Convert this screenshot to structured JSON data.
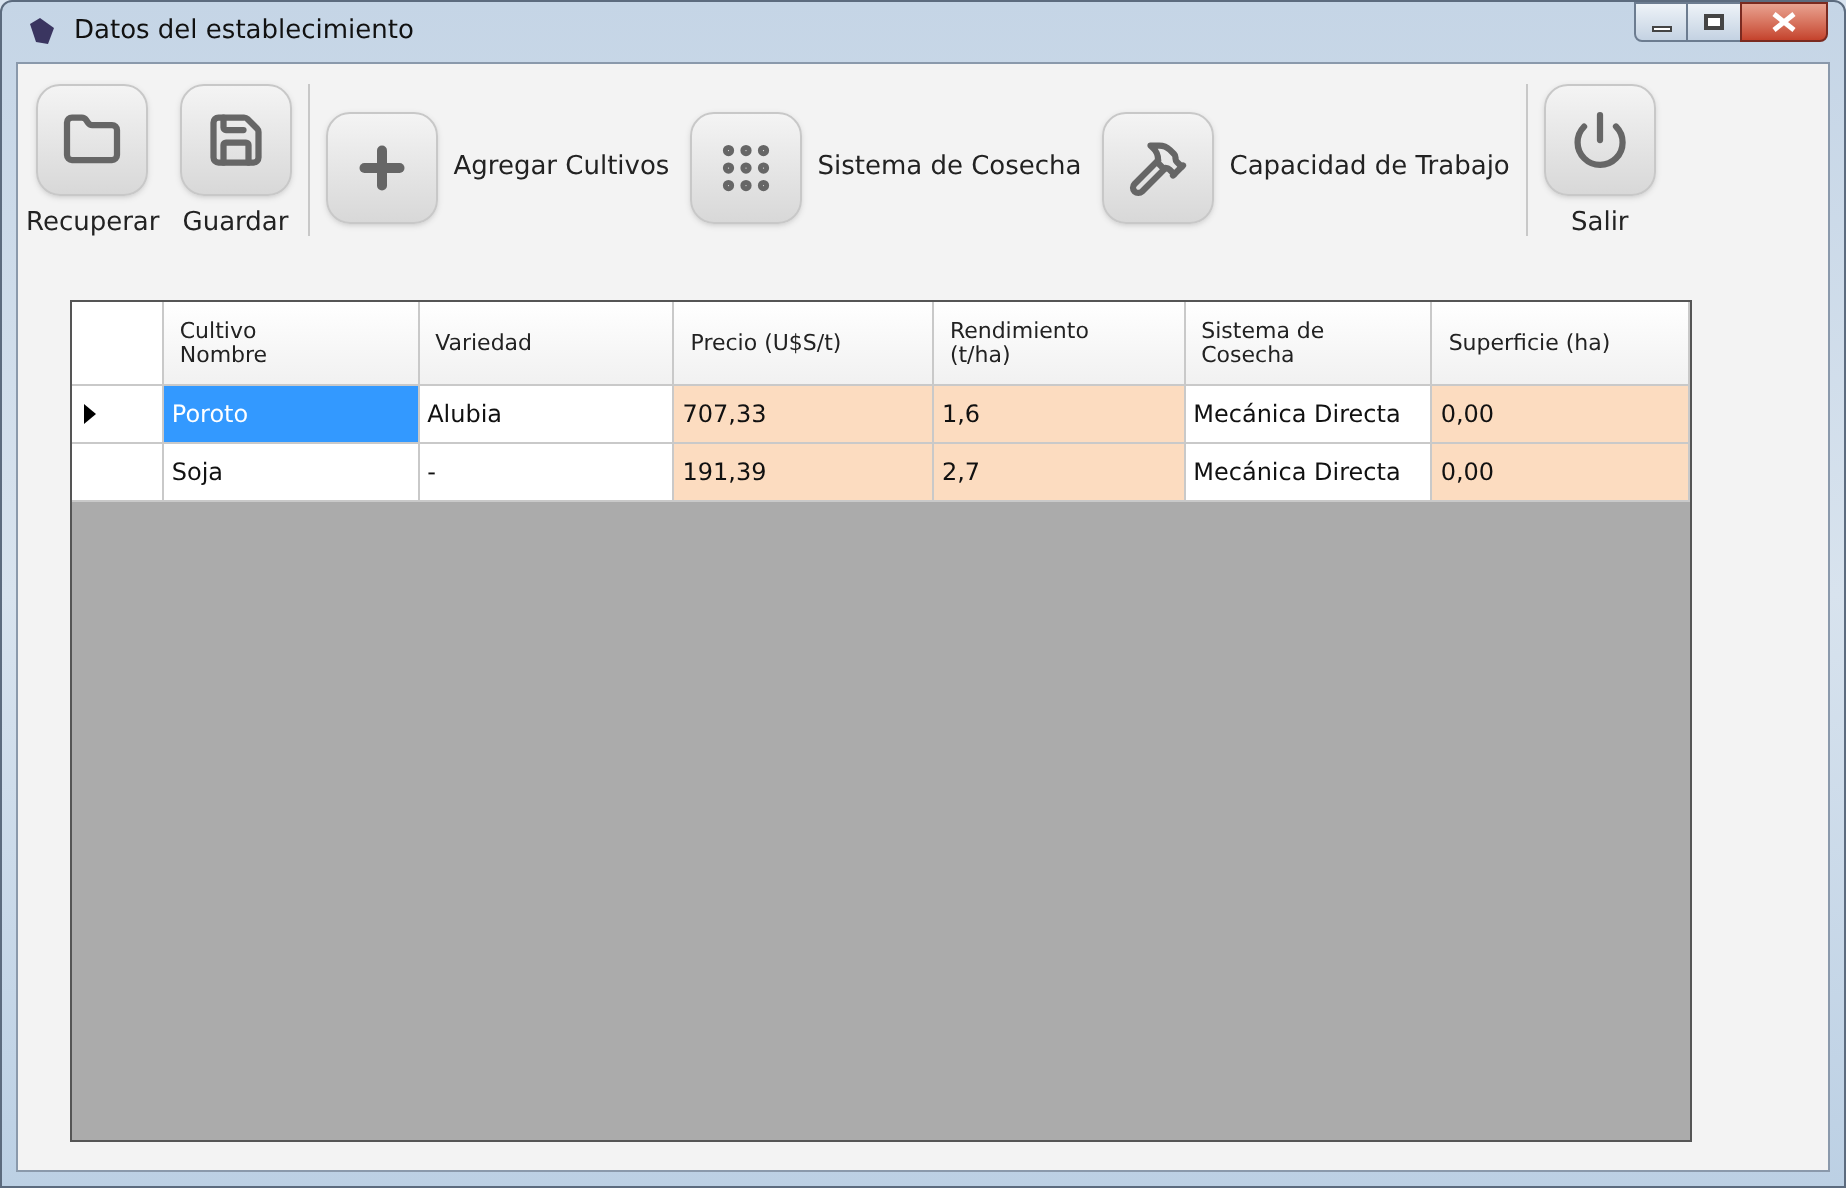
{
  "window": {
    "title": "Datos del establecimiento"
  },
  "toolbar": {
    "groups": [
      [
        {
          "label": "Recuperar",
          "kind": "stacked"
        },
        {
          "label": "Guardar",
          "kind": "stacked"
        }
      ],
      [
        {
          "label": "Agregar Cultivos",
          "kind": "inline"
        },
        {
          "label": "Sistema de Cosecha",
          "kind": "inline"
        },
        {
          "label": "Capacidad de Trabajo",
          "kind": "inline"
        }
      ],
      [
        {
          "label": "Salir",
          "kind": "stacked"
        }
      ]
    ]
  },
  "table": {
    "columns": [
      {
        "label": "Cultivo\nNombre",
        "shaded": false
      },
      {
        "label": "Variedad",
        "shaded": false
      },
      {
        "label": "Precio (U$S/t)",
        "shaded": true
      },
      {
        "label": "Rendimiento\n(t/ha)",
        "shaded": true
      },
      {
        "label": "Sistema de\nCosecha",
        "shaded": false
      },
      {
        "label": "Superficie (ha)",
        "shaded": true
      }
    ],
    "rows": [
      {
        "selected": true,
        "cells": [
          "Poroto",
          "Alubia",
          "707,33",
          "1,6",
          "Mecánica Directa",
          "0,00"
        ]
      },
      {
        "selected": false,
        "cells": [
          "Soja",
          "-",
          "191,39",
          "2,7",
          "Mecánica Directa",
          "0,00"
        ]
      }
    ]
  }
}
